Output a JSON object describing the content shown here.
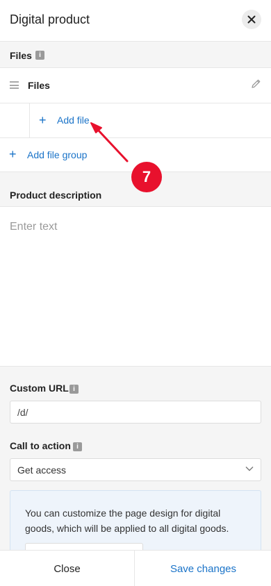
{
  "header": {
    "title": "Digital product"
  },
  "files_section": {
    "label": "Files",
    "group_label": "Files",
    "add_file_label": "Add file",
    "add_file_group_label": "Add file group"
  },
  "description": {
    "label": "Product description",
    "placeholder": "Enter text"
  },
  "custom_url": {
    "label": "Custom URL",
    "value": "/d/"
  },
  "call_to_action": {
    "label": "Call to action",
    "selected": "Get access"
  },
  "info_box": {
    "text": "You can customize the page design for digital goods, which will be applied to all digital goods."
  },
  "footer": {
    "close_label": "Close",
    "save_label": "Save changes"
  },
  "annotation": {
    "step_number": "7",
    "color": "#e8112d"
  },
  "colors": {
    "accent": "#1a73c8",
    "section_bg": "#f5f5f5",
    "border": "#e6e6e6"
  },
  "icons": [
    "close-icon",
    "info-icon",
    "drag-handle-icon",
    "pencil-icon",
    "plus-icon",
    "chevron-down-icon"
  ]
}
